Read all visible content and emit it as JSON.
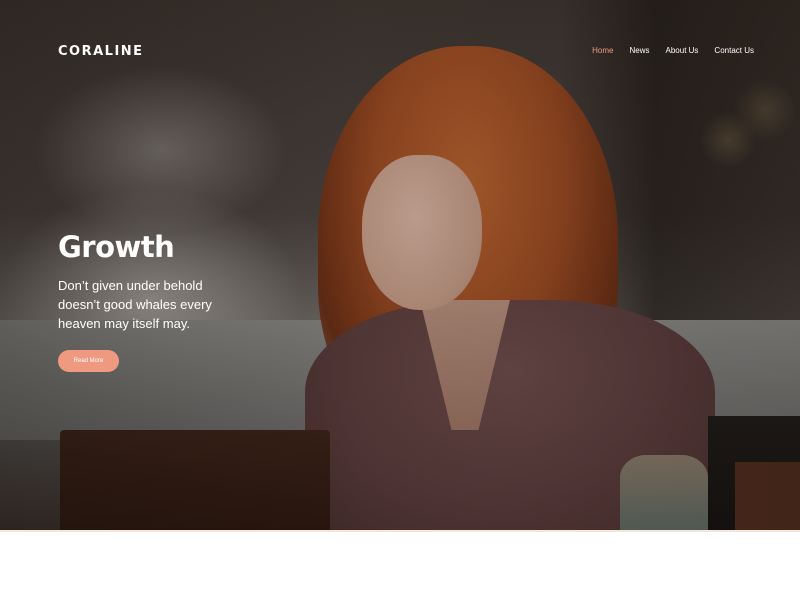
{
  "header": {
    "logo": "CORALINE",
    "nav": [
      {
        "label": "Home",
        "active": true
      },
      {
        "label": "News",
        "active": false
      },
      {
        "label": "About Us",
        "active": false
      },
      {
        "label": "Contact Us",
        "active": false
      }
    ]
  },
  "hero": {
    "title": "Growth",
    "text": "Don’t given under behold doesn’t good whales every heaven may itself may.",
    "button_label": "Read More",
    "background_image": "woman-smiling-cafe-photo"
  },
  "colors": {
    "accent": "#f29b7f",
    "button": "#ef9a80",
    "text": "#ffffff"
  }
}
